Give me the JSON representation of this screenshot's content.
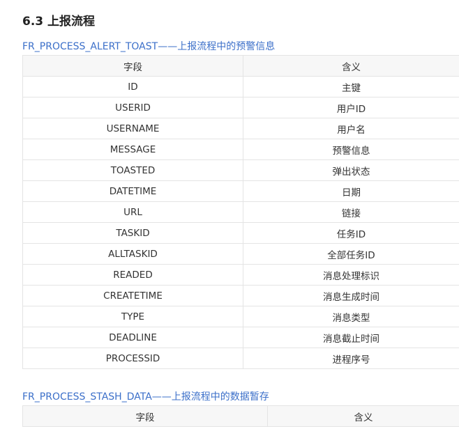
{
  "section": {
    "heading": "6.3 上报流程"
  },
  "tables": [
    {
      "title": "FR_PROCESS_ALERT_TOAST——上报流程中的预警信息",
      "headers": [
        "字段",
        "含义"
      ],
      "rows": [
        [
          "ID",
          "主键"
        ],
        [
          "USERID",
          "用户ID"
        ],
        [
          "USERNAME",
          "用户名"
        ],
        [
          "MESSAGE",
          "预警信息"
        ],
        [
          "TOASTED",
          "弹出状态"
        ],
        [
          "DATETIME",
          "日期"
        ],
        [
          "URL",
          "链接"
        ],
        [
          "TASKID",
          "任务ID"
        ],
        [
          "ALLTASKID",
          "全部任务ID"
        ],
        [
          "READED",
          "消息处理标识"
        ],
        [
          "CREATETIME",
          "消息生成时间"
        ],
        [
          "TYPE",
          "消息类型"
        ],
        [
          "DEADLINE",
          "消息截止时间"
        ],
        [
          "PROCESSID",
          "进程序号"
        ]
      ]
    },
    {
      "title": "FR_PROCESS_STASH_DATA——上报流程中的数据暂存",
      "headers": [
        "字段",
        "含义"
      ],
      "rows": []
    }
  ],
  "colors": {
    "link_title": "#3b6fc9",
    "header_bg": "#f7f7f7",
    "border": "#e4e4e4"
  }
}
